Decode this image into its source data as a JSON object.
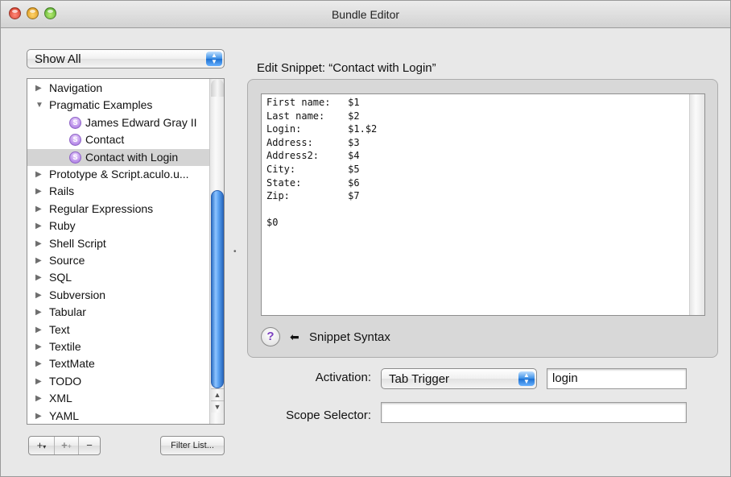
{
  "window": {
    "title": "Bundle Editor",
    "traffic_light_colors": {
      "close": "#d0311f",
      "minimize": "#d69012",
      "zoom": "#4fa82a"
    }
  },
  "filter_popup": {
    "selected": "Show All"
  },
  "bundle_list": {
    "rows": [
      {
        "label": "Navigation",
        "type": "bundle",
        "expanded": false,
        "selected": false
      },
      {
        "label": "Pragmatic Examples",
        "type": "bundle",
        "expanded": true,
        "selected": false
      },
      {
        "label": "James Edward Gray II",
        "type": "snippet",
        "selected": false
      },
      {
        "label": "Contact",
        "type": "snippet",
        "selected": false
      },
      {
        "label": "Contact with Login",
        "type": "snippet",
        "selected": true
      },
      {
        "label": "Prototype & Script.aculo.u...",
        "type": "bundle",
        "expanded": false,
        "selected": false
      },
      {
        "label": "Rails",
        "type": "bundle",
        "expanded": false,
        "selected": false
      },
      {
        "label": "Regular Expressions",
        "type": "bundle",
        "expanded": false,
        "selected": false
      },
      {
        "label": "Ruby",
        "type": "bundle",
        "expanded": false,
        "selected": false
      },
      {
        "label": "Shell Script",
        "type": "bundle",
        "expanded": false,
        "selected": false
      },
      {
        "label": "Source",
        "type": "bundle",
        "expanded": false,
        "selected": false
      },
      {
        "label": "SQL",
        "type": "bundle",
        "expanded": false,
        "selected": false
      },
      {
        "label": "Subversion",
        "type": "bundle",
        "expanded": false,
        "selected": false
      },
      {
        "label": "Tabular",
        "type": "bundle",
        "expanded": false,
        "selected": false
      },
      {
        "label": "Text",
        "type": "bundle",
        "expanded": false,
        "selected": false
      },
      {
        "label": "Textile",
        "type": "bundle",
        "expanded": false,
        "selected": false
      },
      {
        "label": "TextMate",
        "type": "bundle",
        "expanded": false,
        "selected": false
      },
      {
        "label": "TODO",
        "type": "bundle",
        "expanded": false,
        "selected": false
      },
      {
        "label": "XML",
        "type": "bundle",
        "expanded": false,
        "selected": false
      },
      {
        "label": "YAML",
        "type": "bundle",
        "expanded": false,
        "selected": false
      }
    ],
    "snippet_icon": "snippet-s-icon",
    "selection_color": "#d4d4d4",
    "scrollbar_color": "#3a8ee6"
  },
  "bottom_buttons": {
    "add": "+",
    "add_item": "+",
    "remove": "−",
    "filter_list": "Filter List..."
  },
  "editor": {
    "heading": "Edit Snippet: “Contact with Login”",
    "lines": [
      "First name:   $1",
      "Last name:    $2",
      "Login:        $1.$2",
      "Address:      $3",
      "Address2:     $4",
      "City:         $5",
      "State:        $6",
      "Zip:          $7",
      "",
      "$0"
    ],
    "help_label": "?",
    "help_text": "Snippet Syntax",
    "help_arrow_icon": "left-arrow-icon"
  },
  "activation": {
    "label": "Activation:",
    "selected": "Tab Trigger",
    "trigger_value": "login"
  },
  "scope_selector": {
    "label": "Scope Selector:",
    "value": ""
  }
}
